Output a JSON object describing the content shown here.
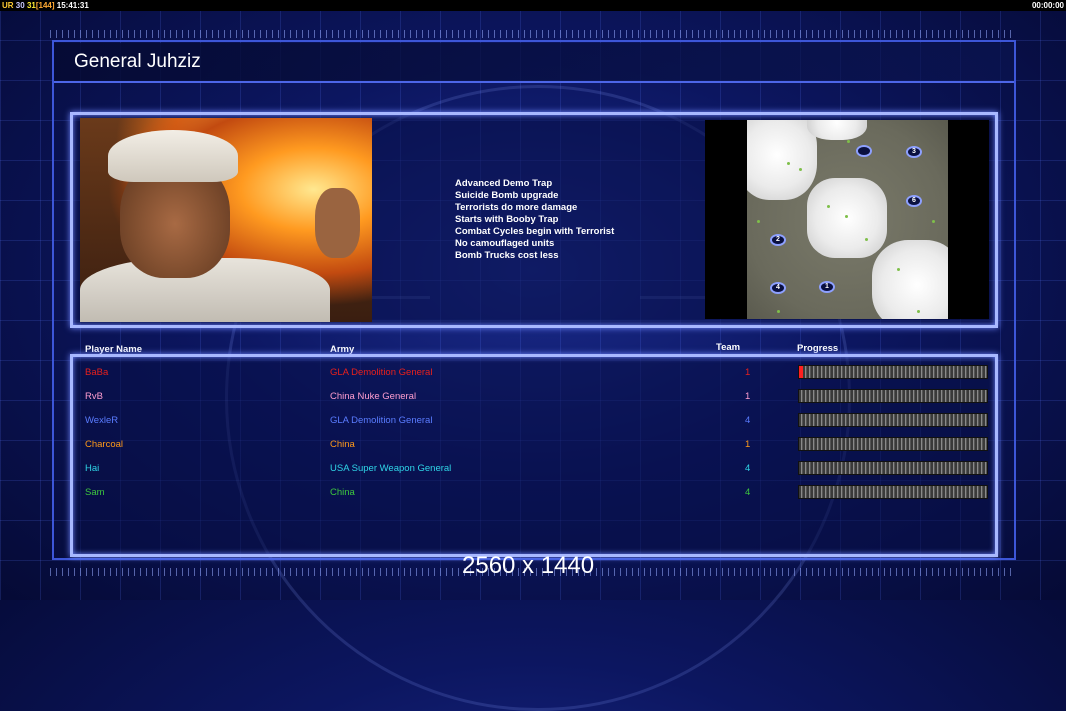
{
  "overlay": {
    "ur_label": "UR",
    "fps_a": "30",
    "fps_b": "31",
    "fps_c": "[144]",
    "clock": "15:41:31",
    "timer": "00:00:00"
  },
  "header": {
    "title": "General Juhziz"
  },
  "perks": [
    "Advanced Demo Trap",
    "Suicide Bomb upgrade",
    "Terrorists do more damage",
    "Starts with Booby Trap",
    "Combat Cycles begin with Terrorist",
    "No camouflaged units",
    "Bomb Trucks cost less"
  ],
  "map": {
    "start_positions": [
      "3",
      "6",
      "2",
      "4",
      "1",
      ""
    ]
  },
  "table": {
    "headers": {
      "player": "Player Name",
      "army": "Army",
      "team": "Team",
      "progress": "Progress"
    },
    "rows": [
      {
        "player": "BaBa",
        "army": "GLA Demolition General",
        "team": "1",
        "color": "#e8201c",
        "progress": 0.02
      },
      {
        "player": "RvB",
        "army": "China Nuke General",
        "team": "1",
        "color": "#ff9ed0",
        "progress": 0
      },
      {
        "player": "WexleR",
        "army": "GLA Demolition General",
        "team": "4",
        "color": "#5a7cff",
        "progress": 0
      },
      {
        "player": "Charcoal",
        "army": "China",
        "team": "1",
        "color": "#ff9a1a",
        "progress": 0
      },
      {
        "player": "Hai",
        "army": "USA Super Weapon General",
        "team": "4",
        "color": "#2fd6e8",
        "progress": 0
      },
      {
        "player": "Sam",
        "army": "China",
        "team": "4",
        "color": "#3ec83e",
        "progress": 0
      }
    ]
  },
  "footer": {
    "resolution": "2560 x 1440"
  }
}
